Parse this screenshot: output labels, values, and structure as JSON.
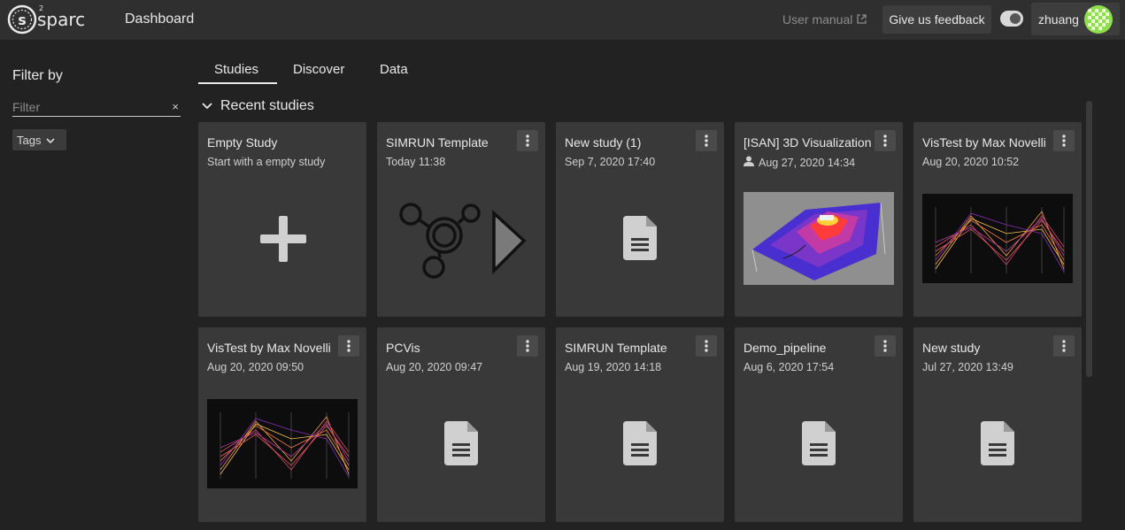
{
  "app": {
    "logo_label": "sparc",
    "title": "Dashboard"
  },
  "header": {
    "manual_label": "User manual",
    "feedback_label": "Give us feedback",
    "username": "zhuang"
  },
  "sidebar": {
    "filter_title": "Filter by",
    "filter_placeholder": "Filter",
    "clear_label": "×",
    "tags_label": "Tags"
  },
  "tabs": [
    {
      "label": "Studies",
      "active": true
    },
    {
      "label": "Discover",
      "active": false
    },
    {
      "label": "Data",
      "active": false
    }
  ],
  "section": {
    "title": "Recent studies"
  },
  "cards": [
    {
      "title": "Empty Study",
      "subtitle": "Start with a empty study",
      "thumb": "plus-icon"
    },
    {
      "title": "SIMRUN Template",
      "subtitle": "Today 11:38",
      "thumb": "simrun-logo"
    },
    {
      "title": "New study (1)",
      "subtitle": "Sep 7, 2020 17:40",
      "thumb": "document-icon"
    },
    {
      "title": "[ISAN] 3D Visualization",
      "subtitle": "Aug 27, 2020 14:34",
      "thumb": "3d-visualization-image",
      "shared": true
    },
    {
      "title": "VisTest by Max Novelli",
      "subtitle": "Aug 20, 2020 10:52",
      "thumb": "parallel-coords-image"
    },
    {
      "title": "VisTest by Max Novelli",
      "subtitle": "Aug 20, 2020 09:50",
      "thumb": "parallel-coords-image"
    },
    {
      "title": "PCVis",
      "subtitle": "Aug 20, 2020 09:47",
      "thumb": "document-icon"
    },
    {
      "title": "SIMRUN Template",
      "subtitle": "Aug 19, 2020 14:18",
      "thumb": "document-icon"
    },
    {
      "title": "Demo_pipeline",
      "subtitle": "Aug 6, 2020 17:54",
      "thumb": "document-icon"
    },
    {
      "title": "New study",
      "subtitle": "Jul 27, 2020 13:49",
      "thumb": "document-icon"
    }
  ],
  "colors": {
    "background": "#222222",
    "topbar": "#2f2f2f",
    "card": "#393939",
    "accent": "#e8e8e8"
  }
}
